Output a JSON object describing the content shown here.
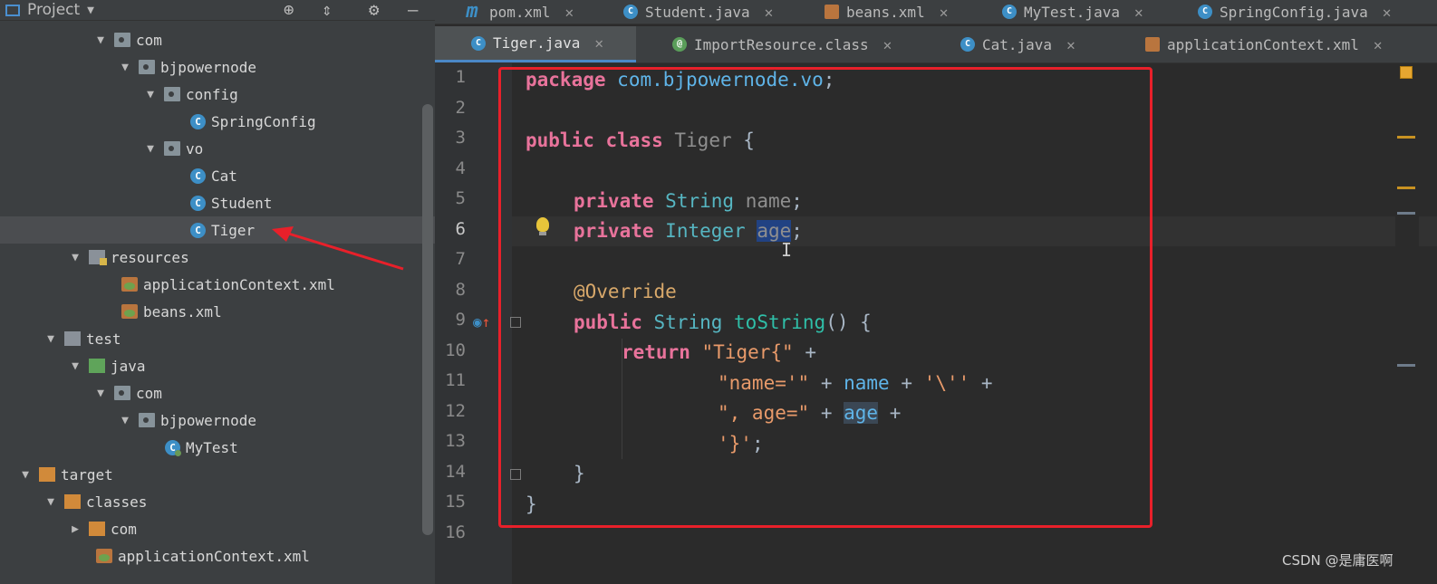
{
  "project_panel": {
    "title": "Project",
    "tree": [
      {
        "label": "com",
        "icon": "package",
        "arrow": "▼"
      },
      {
        "label": "bjpowernode",
        "icon": "package",
        "arrow": "▼"
      },
      {
        "label": "config",
        "icon": "package",
        "arrow": "▼"
      },
      {
        "label": "SpringConfig",
        "icon": "class"
      },
      {
        "label": "vo",
        "icon": "package",
        "arrow": "▼"
      },
      {
        "label": "Cat",
        "icon": "class"
      },
      {
        "label": "Student",
        "icon": "class"
      },
      {
        "label": "Tiger",
        "icon": "class",
        "selected": true
      },
      {
        "label": "resources",
        "icon": "resources-folder",
        "arrow": "▼"
      },
      {
        "label": "applicationContext.xml",
        "icon": "xml"
      },
      {
        "label": "beans.xml",
        "icon": "xml"
      },
      {
        "label": "test",
        "icon": "folder",
        "arrow": "▼"
      },
      {
        "label": "java",
        "icon": "test-source-folder",
        "arrow": "▼"
      },
      {
        "label": "com",
        "icon": "package",
        "arrow": "▼"
      },
      {
        "label": "bjpowernode",
        "icon": "package",
        "arrow": "▼"
      },
      {
        "label": "MyTest",
        "icon": "test-class"
      },
      {
        "label": "target",
        "icon": "excluded-folder",
        "arrow": "▼"
      },
      {
        "label": "classes",
        "icon": "excluded-folder",
        "arrow": "▼"
      },
      {
        "label": "com",
        "icon": "excluded-folder",
        "arrow": "▶"
      },
      {
        "label": "applicationContext.xml",
        "icon": "xml"
      }
    ]
  },
  "tabs_row1": [
    {
      "label": "pom.xml",
      "icon": "maven"
    },
    {
      "label": "Student.java",
      "icon": "class"
    },
    {
      "label": "beans.xml",
      "icon": "xml"
    },
    {
      "label": "MyTest.java",
      "icon": "class"
    },
    {
      "label": "SpringConfig.java",
      "icon": "class"
    }
  ],
  "tabs_row2": [
    {
      "label": "Tiger.java",
      "icon": "class",
      "active": true
    },
    {
      "label": "ImportResource.class",
      "icon": "annotation"
    },
    {
      "label": "Cat.java",
      "icon": "class"
    },
    {
      "label": "applicationContext.xml",
      "icon": "xml"
    }
  ],
  "editor": {
    "current_line": 6,
    "line_numbers": [
      "1",
      "2",
      "3",
      "4",
      "5",
      "6",
      "7",
      "8",
      "9",
      "10",
      "11",
      "12",
      "13",
      "14",
      "15",
      "16"
    ],
    "code": {
      "l1": {
        "kw": "package",
        "pkg": "com.bjpowernode.vo",
        "end": ";"
      },
      "l3": {
        "kw1": "public",
        "kw2": "class",
        "name": "Tiger",
        "end": "{"
      },
      "l5": {
        "kw": "private",
        "type": "String",
        "field": "name",
        "end": ";"
      },
      "l6": {
        "kw": "private",
        "type": "Integer",
        "field": "age",
        "end": ";"
      },
      "l8": {
        "ann": "@Override"
      },
      "l9": {
        "kw": "public",
        "type": "String",
        "method": "toString",
        "end": "() {"
      },
      "l10": {
        "kw": "return",
        "str": "\"Tiger{\"",
        "end": "+"
      },
      "l11": {
        "str1": "\"name='\"",
        "op1": "+",
        "field": "name",
        "op2": "+",
        "str2": "'\\''",
        "op3": "+"
      },
      "l12": {
        "str": "\", age=\"",
        "op1": "+",
        "field": "age",
        "op2": "+"
      },
      "l13": {
        "str": "'}'",
        "end": ";"
      },
      "l14": {
        "brace": "}"
      },
      "l15": {
        "brace": "}"
      }
    }
  },
  "watermark": "CSDN @是庸医啊",
  "colors": {
    "annotation_box": "#e8202a",
    "arrow": "#e8202a",
    "tab_active_underline": "#4a88c7"
  }
}
